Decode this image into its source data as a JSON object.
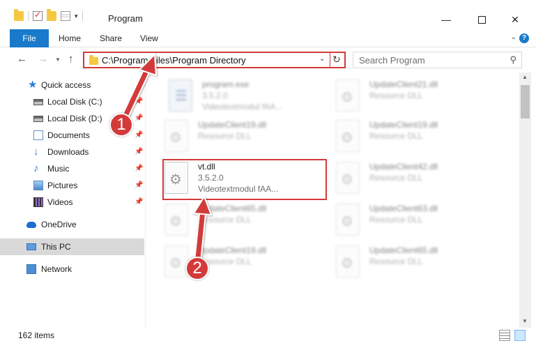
{
  "window": {
    "title": "Program",
    "qat_dropdown": "▾"
  },
  "ribbon": {
    "tabs": [
      "File",
      "Home",
      "Share",
      "View"
    ],
    "expand_icon": "chevron-down-icon",
    "help_icon": "help-icon",
    "help_glyph": "?"
  },
  "nav": {
    "address": "C:\\Program Files\\Program Directory",
    "search_placeholder": "Search Program"
  },
  "sidebar": {
    "items": [
      {
        "label": "Quick access",
        "icon": "star-icon",
        "pinned": false
      },
      {
        "label": "Local Disk (C:)",
        "icon": "disk-icon",
        "pinned": true
      },
      {
        "label": "Local Disk (D:)",
        "icon": "disk-icon",
        "pinned": true
      },
      {
        "label": "Documents",
        "icon": "documents-icon",
        "pinned": true
      },
      {
        "label": "Downloads",
        "icon": "download-icon",
        "pinned": true
      },
      {
        "label": "Music",
        "icon": "music-icon",
        "pinned": true
      },
      {
        "label": "Pictures",
        "icon": "pictures-icon",
        "pinned": true
      },
      {
        "label": "Videos",
        "icon": "videos-icon",
        "pinned": true
      },
      {
        "label": "OneDrive",
        "icon": "cloud-icon",
        "pinned": false
      },
      {
        "label": "This PC",
        "icon": "computer-icon",
        "pinned": false
      },
      {
        "label": "Network",
        "icon": "network-icon",
        "pinned": false
      }
    ]
  },
  "files": [
    {
      "name": "program.exe",
      "line1": "3.5.2.0",
      "line2": "Videotextmodul fAA..."
    },
    {
      "name": "UpdateClient21.dll",
      "line1": "Resource DLL",
      "line2": ""
    },
    {
      "name": "UpdateClient19.dll",
      "line1": "Resource DLL",
      "line2": ""
    },
    {
      "name": "UpdateClient19.dll",
      "line1": "Resource DLL",
      "line2": ""
    },
    {
      "name": "vt.dll",
      "line1": "3.5.2.0",
      "line2": "Videotextmodul fAA..."
    },
    {
      "name": "UpdateClient42.dll",
      "line1": "Resource DLL",
      "line2": ""
    },
    {
      "name": "UpdateClient65.dll",
      "line1": "Resource DLL",
      "line2": ""
    },
    {
      "name": "UpdateClient63.dll",
      "line1": "Resource DLL",
      "line2": ""
    },
    {
      "name": "UpdateClient19.dll",
      "line1": "Resource DLL",
      "line2": ""
    },
    {
      "name": "UpdateClient65.dll",
      "line1": "Resource DLL",
      "line2": ""
    }
  ],
  "status": {
    "item_count": "162 items"
  },
  "annotations": {
    "step1": "1",
    "step2": "2",
    "color": "#d33a3a"
  },
  "colors": {
    "accent": "#1979ca",
    "highlight": "#d33a3a"
  }
}
